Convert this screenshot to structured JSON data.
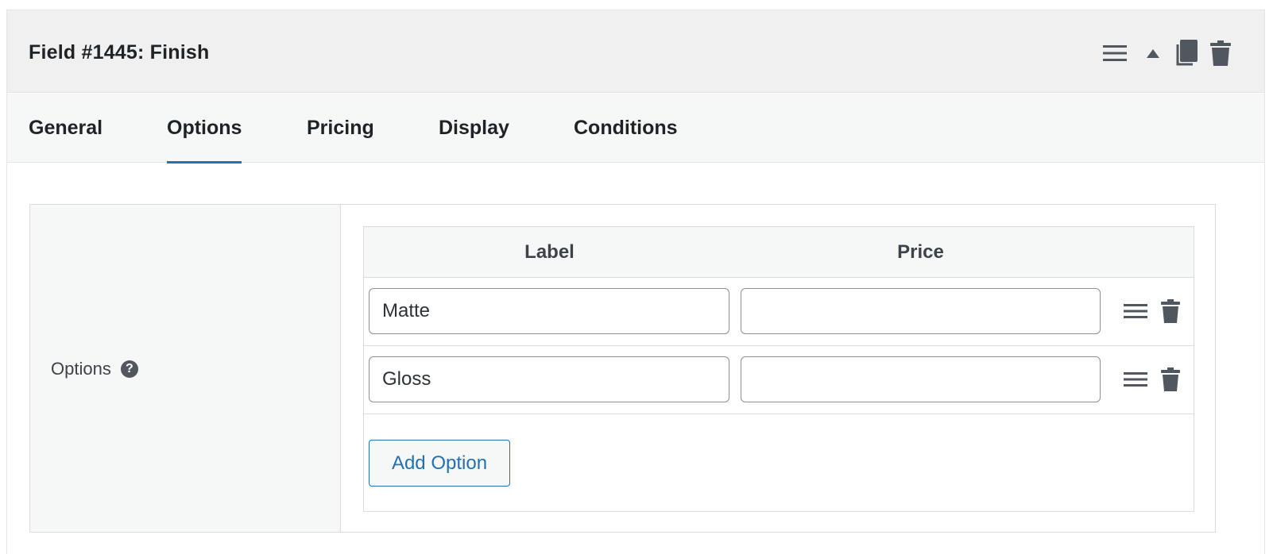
{
  "field": {
    "title": "Field #1445: Finish",
    "actions": {
      "menu_icon": "hamburger-menu-icon",
      "toggle_icon": "triangle-up-icon",
      "copy_icon": "copy-icon",
      "trash_icon": "trash-icon"
    }
  },
  "tabs": [
    {
      "label": "General",
      "active": false
    },
    {
      "label": "Options",
      "active": true
    },
    {
      "label": "Pricing",
      "active": false
    },
    {
      "label": "Display",
      "active": false
    },
    {
      "label": "Conditions",
      "active": false
    }
  ],
  "options_section": {
    "label": "Options",
    "help_glyph": "?",
    "columns": {
      "label": "Label",
      "price": "Price"
    },
    "rows": [
      {
        "label": "Matte",
        "price": ""
      },
      {
        "label": "Gloss",
        "price": ""
      }
    ],
    "add_button": "Add Option"
  },
  "colors": {
    "accent": "#2271b1",
    "header_bg": "#f0f0f1",
    "icon": "#50575e"
  }
}
